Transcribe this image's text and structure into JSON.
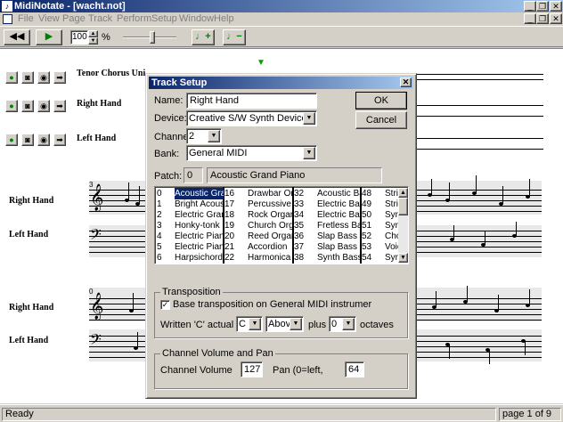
{
  "window": {
    "title": "MidiNotate - [wacht.not]"
  },
  "menubar": {
    "items": [
      "File",
      "View",
      "Page",
      "Track",
      "Perform",
      "Setup",
      "Window",
      "Help"
    ]
  },
  "toolbar": {
    "zoom_value": "100",
    "zoom_unit": "%"
  },
  "tracks_top": [
    {
      "label": "Tenor Chorus Uni"
    },
    {
      "label": "Right Hand"
    },
    {
      "label": "Left Hand"
    }
  ],
  "system2": {
    "measure": "3",
    "labels": [
      "Right Hand",
      "Left Hand"
    ]
  },
  "system3": {
    "measure": "0",
    "labels": [
      "Right Hand",
      "Left Hand"
    ]
  },
  "status": {
    "left": "Ready",
    "right": "page 1 of 9"
  },
  "dialog": {
    "title": "Track Setup",
    "name_label": "Name:",
    "name_value": "Right Hand",
    "device_label": "Device:",
    "device_value": "Creative S/W Synth Device",
    "channel_label": "Channel:",
    "channel_value": "2",
    "bank_label": "Bank:",
    "bank_value": "General MIDI",
    "patch_label": "Patch:",
    "patch_number": "0",
    "patch_name": "Acoustic Grand Piano",
    "ok_label": "OK",
    "cancel_label": "Cancel",
    "patch_columns": [
      {
        "numbers": [
          "0",
          "1",
          "2",
          "3",
          "4",
          "5",
          "6"
        ],
        "names": [
          "Acoustic Gran",
          "Bright Acoust",
          "Electric Gran",
          "Honky-tonk Pi",
          "Electric Piano",
          "Electric Piano",
          "Harpsichord"
        ]
      },
      {
        "numbers": [
          "16",
          "17",
          "18",
          "19",
          "20",
          "21",
          "22"
        ],
        "names": [
          "Drawbar Org",
          "Percussive O",
          "Rock Organ",
          "Church Orga",
          "Reed Organ",
          "Accordion",
          "Harmonica"
        ]
      },
      {
        "numbers": [
          "32",
          "33",
          "34",
          "35",
          "36",
          "37",
          "38"
        ],
        "names": [
          "Acoustic Bas",
          "Electric Bas",
          "Electric Bas",
          "Fretless Bas",
          "Slap Bass 1",
          "Slap Bass 2",
          "Synth Bass 1"
        ]
      },
      {
        "numbers": [
          "48",
          "49",
          "50",
          "51",
          "52",
          "53",
          "54"
        ],
        "names": [
          "Strin",
          "Strin",
          "Synt",
          "Synt",
          "Choi",
          "Voic",
          "Synt"
        ]
      }
    ],
    "transposition": {
      "group_label": "Transposition",
      "checkbox_label": "Base transposition on General MIDI instrumer",
      "written_label": "Written 'C' actual pitch",
      "pitch_value": "C",
      "direction_value": "Above",
      "plus_label": "plus",
      "octaves_value": "0",
      "octaves_label": "octaves"
    },
    "channel_volume": {
      "group_label": "Channel Volume and Pan",
      "volume_label": "Channel Volume",
      "volume_value": "127",
      "pan_label": "Pan (0=left,",
      "pan_value": "64"
    }
  }
}
